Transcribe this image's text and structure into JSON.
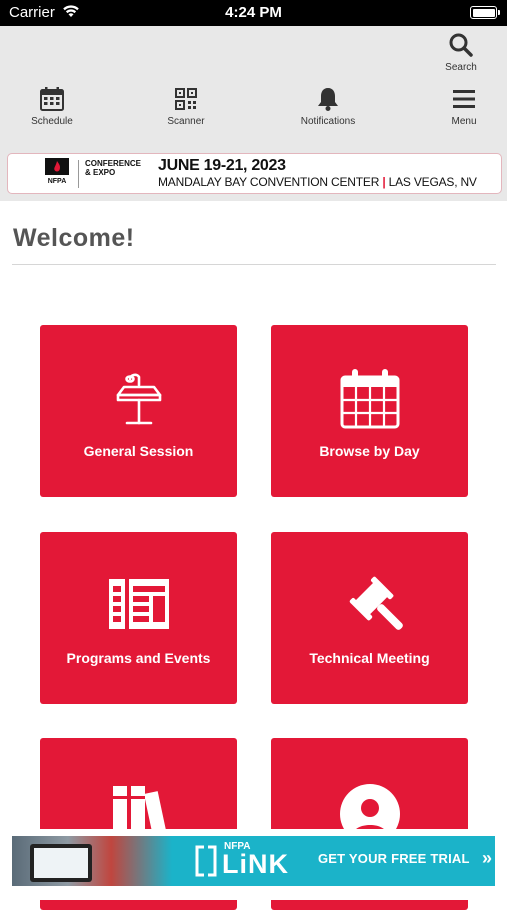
{
  "status_bar": {
    "carrier": "Carrier",
    "time": "4:24 PM"
  },
  "toolbar": {
    "search": {
      "label": "Search",
      "icon": "search-icon"
    },
    "schedule": {
      "label": "Schedule",
      "icon": "calendar-icon"
    },
    "scanner": {
      "label": "Scanner",
      "icon": "qr-code-icon"
    },
    "notifications": {
      "label": "Notifications",
      "icon": "bell-icon"
    },
    "menu": {
      "label": "Menu",
      "icon": "hamburger-icon"
    }
  },
  "banner": {
    "org": "NFPA",
    "event": "CONFERENCE & EXPO",
    "dates": "JUNE 19-21, 2023",
    "venue": "MANDALAY BAY CONVENTION CENTER",
    "city": "LAS VEGAS, NV"
  },
  "welcome": "Welcome!",
  "tiles": [
    {
      "label": "General Session",
      "icon": "podium-icon"
    },
    {
      "label": "Browse by Day",
      "icon": "calendar-icon"
    },
    {
      "label": "Programs and Events",
      "icon": "program-list-icon"
    },
    {
      "label": "Technical Meeting",
      "icon": "gavel-icon"
    },
    {
      "label": "",
      "icon": "books-icon"
    },
    {
      "label": "",
      "icon": "user-icon"
    }
  ],
  "ad": {
    "brand": "NFPA",
    "product": "LiNK",
    "cta": "GET YOUR FREE TRIAL"
  },
  "colors": {
    "brand_red": "#e31837",
    "header_gray": "#e8e8e8",
    "ad_teal": "#1bb3c9"
  }
}
